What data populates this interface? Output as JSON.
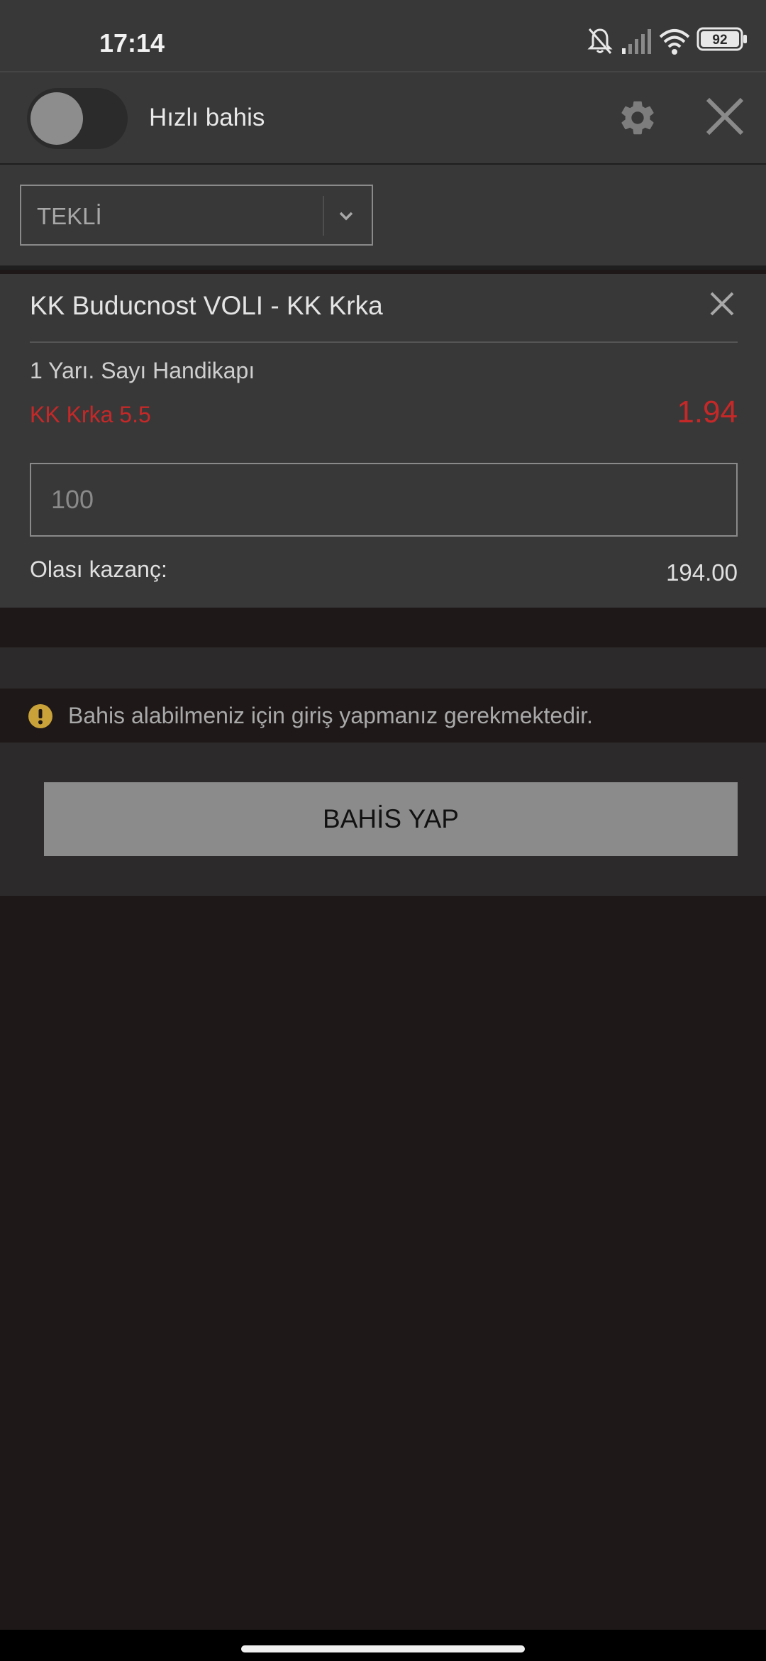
{
  "status_bar": {
    "time": "17:14",
    "battery_level": "92",
    "icons": [
      "bell-off-icon",
      "signal-icon",
      "wifi-icon",
      "battery-icon"
    ]
  },
  "topbar": {
    "quick_bet_label": "Hızlı bahis",
    "quick_bet_enabled": false,
    "icons": [
      "gear-icon",
      "close-icon"
    ]
  },
  "bet_type": {
    "selected": "TEKLİ"
  },
  "bet": {
    "match": "KK Buducnost VOLI - KK Krka",
    "market": "1 Yarı. Sayı Handikapı",
    "selection": "KK Krka 5.5",
    "odds": "1.94",
    "stake_placeholder": "100",
    "payout_label": "Olası kazanç:",
    "payout_value": "194.00"
  },
  "warning": {
    "text": "Bahis alabilmeniz için giriş yapmanız gerekmektedir."
  },
  "actions": {
    "place_bet_label": "BAHİS YAP"
  },
  "colors": {
    "odds_red": "#c62828",
    "warning_yellow": "#c9a23a",
    "panel": "#383838",
    "background": "#1e1818",
    "button": "#8b8b8b"
  }
}
